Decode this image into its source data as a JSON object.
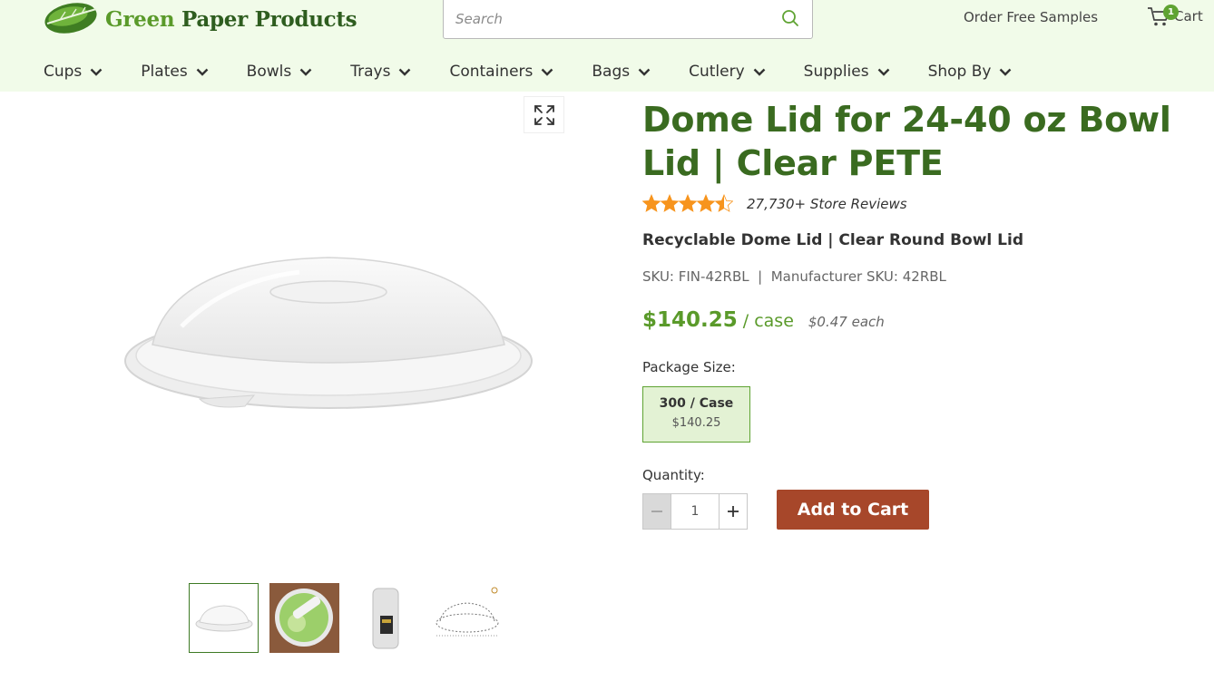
{
  "header": {
    "logo": {
      "green": "Green",
      "dark": "Paper Products"
    },
    "search": {
      "placeholder": "Search",
      "value": ""
    },
    "order_samples": "Order Free Samples",
    "cart": {
      "label": "Cart",
      "count": "1"
    }
  },
  "nav": {
    "items": [
      {
        "label": "Cups"
      },
      {
        "label": "Plates"
      },
      {
        "label": "Bowls"
      },
      {
        "label": "Trays"
      },
      {
        "label": "Containers"
      },
      {
        "label": "Bags"
      },
      {
        "label": "Cutlery"
      },
      {
        "label": "Supplies"
      },
      {
        "label": "Shop By"
      }
    ]
  },
  "product": {
    "title": "Dome Lid for 24-40 oz Bowl Lid | Clear PETE",
    "rating_value": 4.5,
    "rating_max": 5,
    "reviews": "27,730+ Store Reviews",
    "subtitle": "Recyclable Dome Lid | Clear Round Bowl Lid",
    "sku": "SKU: FIN-42RBL  |  Manufacturer SKU: 42RBL",
    "price": "$140.25",
    "price_unit": "/ case",
    "price_each": "$0.47 each",
    "package_label": "Package Size:",
    "package_option": {
      "size": "300 / Case",
      "price": "$140.25"
    },
    "quantity_label": "Quantity:",
    "quantity_value": "1",
    "add_to_cart": "Add to Cart"
  },
  "colors": {
    "header_bg": "#f1fbe9",
    "title_green": "#3a6b20",
    "price_green": "#5a9a2a",
    "star_orange": "#f7941d",
    "cart_button": "#a7472a"
  }
}
